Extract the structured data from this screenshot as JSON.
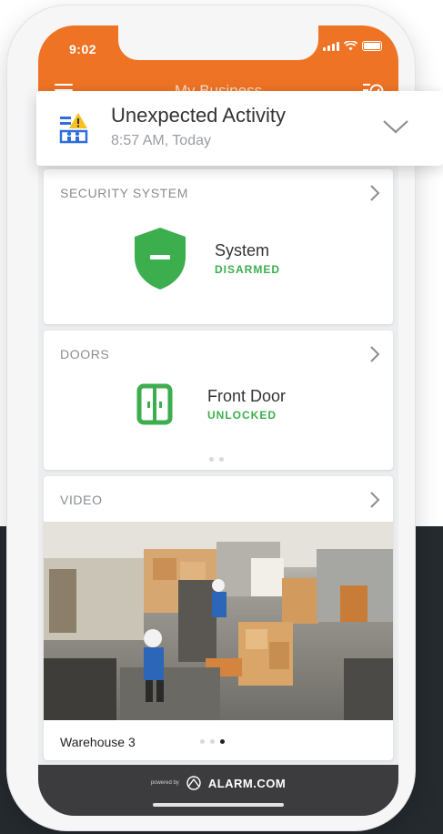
{
  "status_bar": {
    "time": "9:02"
  },
  "header": {
    "title": "My Business"
  },
  "notification": {
    "title": "Unexpected Activity",
    "time": "8:57 AM, Today"
  },
  "security": {
    "heading": "SECURITY SYSTEM",
    "name": "System",
    "state": "DISARMED",
    "state_color": "#3dae4e"
  },
  "doors": {
    "heading": "DOORS",
    "name": "Front Door",
    "state": "UNLOCKED",
    "page_count": 2,
    "active_page": 1
  },
  "video": {
    "heading": "VIDEO",
    "camera_name": "Warehouse 3",
    "page_count": 3,
    "active_page": 3
  },
  "footer": {
    "powered_by": "powered by",
    "brand": "ALARM.COM"
  },
  "colors": {
    "brand_orange": "#ee7325",
    "ok_green": "#3dae4e",
    "footer_dark": "#3c3c3e",
    "alert_yellow": "#f6c01e",
    "icon_blue": "#2f6fdc"
  },
  "icons": {
    "menu": "hamburger-icon",
    "tasks": "checklist-icon",
    "notification": "activity-alert-icon",
    "security": "shield-icon",
    "door": "door-icon",
    "chevron": "chevron-right-icon"
  }
}
